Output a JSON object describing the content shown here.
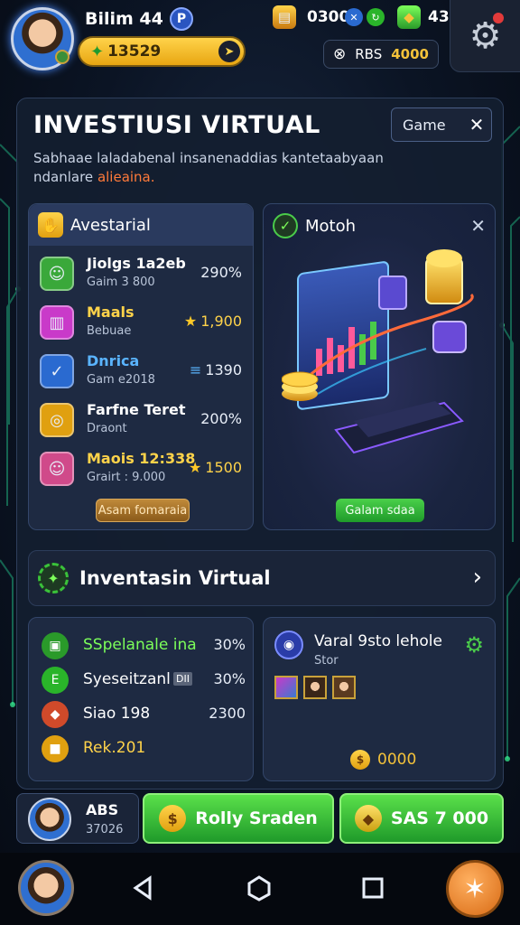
{
  "header": {
    "player_name": "Bilim 44",
    "player_badge": "P",
    "coins": "13529",
    "res1_value": "0300",
    "res2_value": "43",
    "rbs_label": "RBS",
    "rbs_value": "4000"
  },
  "panel": {
    "title": "INVESTIUSI VIRTUAL",
    "game_button": "Game",
    "desc_main": "Sabhaae laladabenal insanenaddias kantetaabyaan ndanlare",
    "desc_highlight": "alieaina."
  },
  "investments": {
    "title": "Avestarial",
    "items": [
      {
        "name": "Jiolgs 1a2eb",
        "sub": "Gaim 3 800",
        "value": "290%",
        "color": "#ffffff",
        "icon_bg": "#3aa83a",
        "icon": "face"
      },
      {
        "name": "Maals",
        "sub": "Bebuae",
        "value": "1,900",
        "color": "#ffd34a",
        "icon_bg": "#c93ac9",
        "icon": "chart"
      },
      {
        "name": "Dnrica",
        "sub": "Gam e2018",
        "value": "1390",
        "color": "#5ab4ff",
        "icon_bg": "#2a6ad0",
        "icon": "check"
      },
      {
        "name": "Farfne Teret",
        "sub": "Draont",
        "value": "200%",
        "color": "#ffffff",
        "icon_bg": "#e0a010",
        "icon": "coins"
      },
      {
        "name": "Maois 12:338",
        "sub": "Grairt : 9.000",
        "value": "1500",
        "color": "#ffd34a",
        "icon_bg": "#d04a8a",
        "icon": "face"
      }
    ],
    "button": "Asam fomaraia"
  },
  "motoh": {
    "title": "Motoh",
    "button": "Galam sdaa"
  },
  "inventasin": {
    "title": "Inventasin Virtual"
  },
  "stats": {
    "items": [
      {
        "name": "SSpelanale ina",
        "value": "30%",
        "color": "#7cff5a",
        "icon_bg": "#2a9a2a",
        "icon": "▣"
      },
      {
        "name": "Syeseitzanl",
        "value": "30%",
        "color": "#ffffff",
        "icon_bg": "#2ab42a",
        "icon": "E"
      },
      {
        "name": "Siao 198",
        "value": "2300",
        "color": "#ffffff",
        "icon_bg": "#d04a2a",
        "icon": "◆",
        "highlight": "198"
      },
      {
        "name": "Rek.201",
        "value": "",
        "color": "#ffd34a",
        "icon_bg": "#e0a010",
        "icon": "■"
      }
    ],
    "badge": "DII"
  },
  "varal": {
    "title": "Varal 9sto lehole",
    "sub": "Stor",
    "coins": "0000"
  },
  "actions": {
    "profile_name": "ABS",
    "profile_sub": "37026",
    "btn1_label": "Rolly Sraden",
    "btn2_label": "SAS 7 000"
  },
  "colors": {
    "accent_green": "#3ac23a",
    "accent_gold": "#f4c23a",
    "panel_bg": "#141e30"
  }
}
